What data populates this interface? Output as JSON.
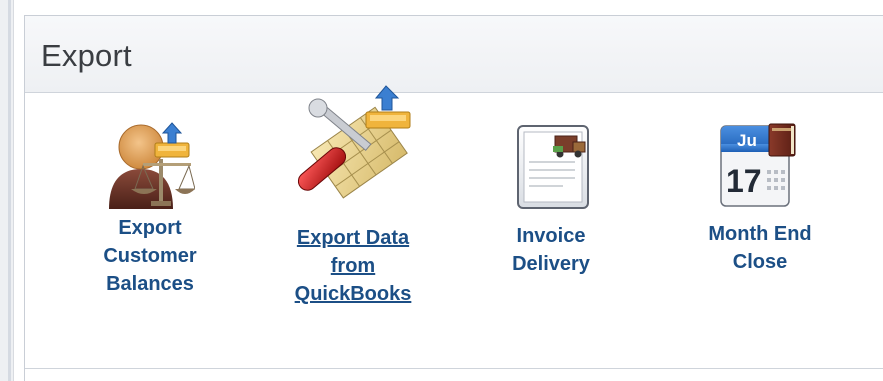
{
  "section": {
    "title": "Export"
  },
  "tiles": [
    {
      "icon": "customer-balances-icon",
      "lines": [
        "Export",
        "Customer",
        "Balances"
      ]
    },
    {
      "icon": "export-data-icon",
      "lines": [
        "Export Data",
        "from",
        "QuickBooks"
      ],
      "hovered": true
    },
    {
      "icon": "invoice-delivery-icon",
      "lines": [
        "Invoice",
        "Delivery"
      ]
    },
    {
      "icon": "calendar-icon",
      "lines": [
        "Month End",
        "Close"
      ],
      "calendar_month": "Ju",
      "calendar_day": "17"
    }
  ],
  "colors": {
    "label": "#1c4f86",
    "header_bg": "#eef0f3",
    "title": "#3a3d42"
  }
}
